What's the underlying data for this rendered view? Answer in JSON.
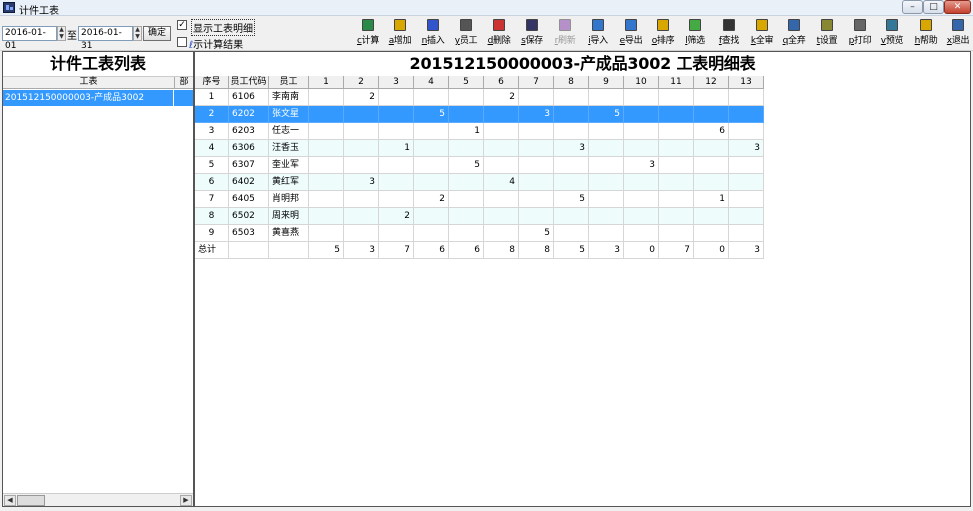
{
  "window": {
    "title": "计件工表",
    "buttons": {
      "min": "–",
      "max": "□",
      "close": "✕"
    }
  },
  "filters": {
    "start_date": "2016-01-01",
    "to_label": "至",
    "end_date": "2016-01-31",
    "ok_label": "确定",
    "show_detail": {
      "label": "显示工表明细",
      "checked": true
    },
    "show_calc": {
      "label": "示计算结果",
      "checked": false
    }
  },
  "toolbar": [
    {
      "key": "c",
      "label": "计算",
      "icon": "calculate-icon",
      "color": "#2a8a4a"
    },
    {
      "key": "a",
      "label": "增加",
      "icon": "add-icon",
      "color": "#d9a800"
    },
    {
      "key": "n",
      "label": "插入",
      "icon": "insert-icon",
      "color": "#3355cc"
    },
    {
      "key": "y",
      "label": "员工",
      "icon": "employee-icon",
      "color": "#555555"
    },
    {
      "key": "d",
      "label": "删除",
      "icon": "delete-icon",
      "color": "#cc3333"
    },
    {
      "key": "s",
      "label": "保存",
      "icon": "save-icon",
      "color": "#333366"
    },
    {
      "key": "r",
      "label": "刷新",
      "icon": "refresh-icon",
      "color": "#8844aa",
      "disabled": true
    },
    {
      "key": "i",
      "label": "导入",
      "icon": "import-icon",
      "color": "#3377cc"
    },
    {
      "key": "e",
      "label": "导出",
      "icon": "export-icon",
      "color": "#3377cc"
    },
    {
      "key": "o",
      "label": "排序",
      "icon": "sort-icon",
      "color": "#d9a800"
    },
    {
      "key": "l",
      "label": "筛选",
      "icon": "filter-icon",
      "color": "#44aa44"
    },
    {
      "key": "f",
      "label": "查找",
      "icon": "find-icon",
      "color": "#333333"
    },
    {
      "key": "k",
      "label": "全审",
      "icon": "approve-icon",
      "color": "#d9a800"
    },
    {
      "key": "q",
      "label": "全弃",
      "icon": "discard-icon",
      "color": "#3366aa"
    },
    {
      "key": "t",
      "label": "设置",
      "icon": "settings-icon",
      "color": "#888833"
    },
    {
      "key": "p",
      "label": "打印",
      "icon": "print-icon",
      "color": "#666666"
    },
    {
      "key": "v",
      "label": "预览",
      "icon": "preview-icon",
      "color": "#337799"
    },
    {
      "key": "h",
      "label": "帮助",
      "icon": "help-icon",
      "color": "#d9a800"
    },
    {
      "key": "x",
      "label": "退出",
      "icon": "exit-icon",
      "color": "#3366aa"
    }
  ],
  "left_panel": {
    "title": "计件工表列表",
    "header": [
      "工表",
      "部"
    ],
    "rows": [
      {
        "name": "201512150000003-产成品3002",
        "dept": ""
      }
    ]
  },
  "main": {
    "title": "201512150000003-产成品3002 工表明细表",
    "columns": [
      "序号",
      "员工代码",
      "员工",
      "1",
      "2",
      "3",
      "4",
      "5",
      "6",
      "7",
      "8",
      "9",
      "10",
      "11",
      "12",
      "13"
    ],
    "rows": [
      {
        "no": "1",
        "code": "6106",
        "name": "李南南",
        "values": [
          "",
          "2",
          "",
          "",
          "",
          "2",
          "",
          "",
          "",
          "",
          "",
          "",
          ""
        ]
      },
      {
        "no": "2",
        "code": "6202",
        "name": "张文星",
        "values": [
          "",
          "",
          "",
          "5",
          "",
          "",
          "3",
          "",
          "5",
          "",
          "",
          "",
          ""
        ]
      },
      {
        "no": "3",
        "code": "6203",
        "name": "任志一",
        "values": [
          "",
          "",
          "",
          "",
          "1",
          "",
          "",
          "",
          "",
          "",
          "",
          "6",
          ""
        ]
      },
      {
        "no": "4",
        "code": "6306",
        "name": "汪香玉",
        "values": [
          "",
          "",
          "1",
          "",
          "",
          "",
          "",
          "3",
          "",
          "",
          "",
          "",
          "3"
        ]
      },
      {
        "no": "5",
        "code": "6307",
        "name": "奎业军",
        "values": [
          "",
          "",
          "",
          "",
          "5",
          "",
          "",
          "",
          "",
          "3",
          "",
          "",
          ""
        ]
      },
      {
        "no": "6",
        "code": "6402",
        "name": "黄红军",
        "values": [
          "",
          "3",
          "",
          "",
          "",
          "4",
          "",
          "",
          "",
          "",
          "",
          "",
          ""
        ]
      },
      {
        "no": "7",
        "code": "6405",
        "name": "肖明邦",
        "values": [
          "",
          "",
          "",
          "2",
          "",
          "",
          "",
          "5",
          "",
          "",
          "",
          "1",
          ""
        ]
      },
      {
        "no": "8",
        "code": "6502",
        "name": "周来明",
        "values": [
          "",
          "",
          "2",
          "",
          "",
          "",
          "",
          "",
          "",
          "",
          "",
          "",
          ""
        ]
      },
      {
        "no": "9",
        "code": "6503",
        "name": "黄喜燕",
        "values": [
          "",
          "",
          "",
          "",
          "",
          "",
          "5",
          "",
          "",
          "",
          "",
          "",
          ""
        ]
      }
    ],
    "selected_row": 1,
    "total": {
      "label": "总计",
      "values": [
        "5",
        "3",
        "7",
        "6",
        "6",
        "8",
        "8",
        "5",
        "3",
        "0",
        "7",
        "0",
        "3"
      ]
    }
  },
  "colors": {
    "selection": "#3399ff",
    "alt_row": "#eefcfc"
  }
}
